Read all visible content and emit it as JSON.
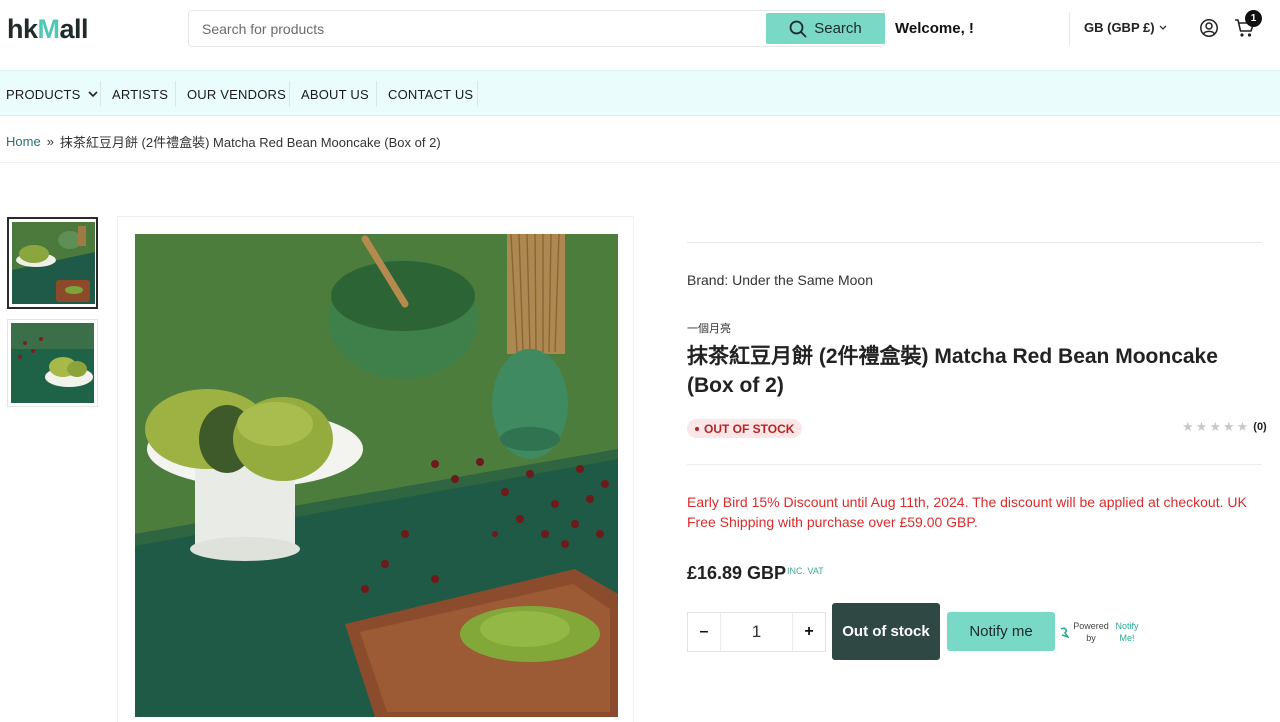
{
  "header": {
    "logo_text_a": "hk",
    "logo_text_b": "M",
    "logo_text_c": "all",
    "search_placeholder": "Search for products",
    "search_button_label": "Search",
    "welcome_text": "Welcome, !",
    "currency_label": "GB (GBP £)",
    "cart_count": "1"
  },
  "nav": {
    "items": [
      {
        "label": "PRODUCTS"
      },
      {
        "label": "ARTISTS"
      },
      {
        "label": "OUR VENDORS"
      },
      {
        "label": "ABOUT US"
      },
      {
        "label": "CONTACT US"
      }
    ]
  },
  "breadcrumb": {
    "home": "Home",
    "separator": "»",
    "current": "抹茶紅豆月餅 (2件禮盒裝) Matcha Red Bean Mooncake (Box of 2)"
  },
  "product": {
    "brand_line": "Brand: Under the Same Moon",
    "vendor_cn": "一個月亮",
    "title": "抹茶紅豆月餅 (2件禮盒裝) Matcha Red Bean Mooncake (Box of 2)",
    "stock_status": "OUT OF STOCK",
    "rating_stars": 0,
    "review_count": "(0)",
    "promo_text": "Early Bird 15% Discount until Aug 11th, 2024. The discount will be applied at checkout. UK Free Shipping with purchase over £59.00 GBP.",
    "price": "£16.89 GBP",
    "vat_note": "INC. VAT",
    "quantity": "1",
    "qty_minus": "–",
    "qty_plus": "+",
    "out_of_stock_button": "Out of stock",
    "notify_button": "Notify me",
    "powered_by": "Powered by",
    "notify_brand": "Notify Me!"
  },
  "colors": {
    "accent": "#7ad8c7",
    "nav_bg": "#eafcfb",
    "dark_button": "#2f4844",
    "promo_red": "#d92c2c",
    "stock_red": "#b42424"
  }
}
